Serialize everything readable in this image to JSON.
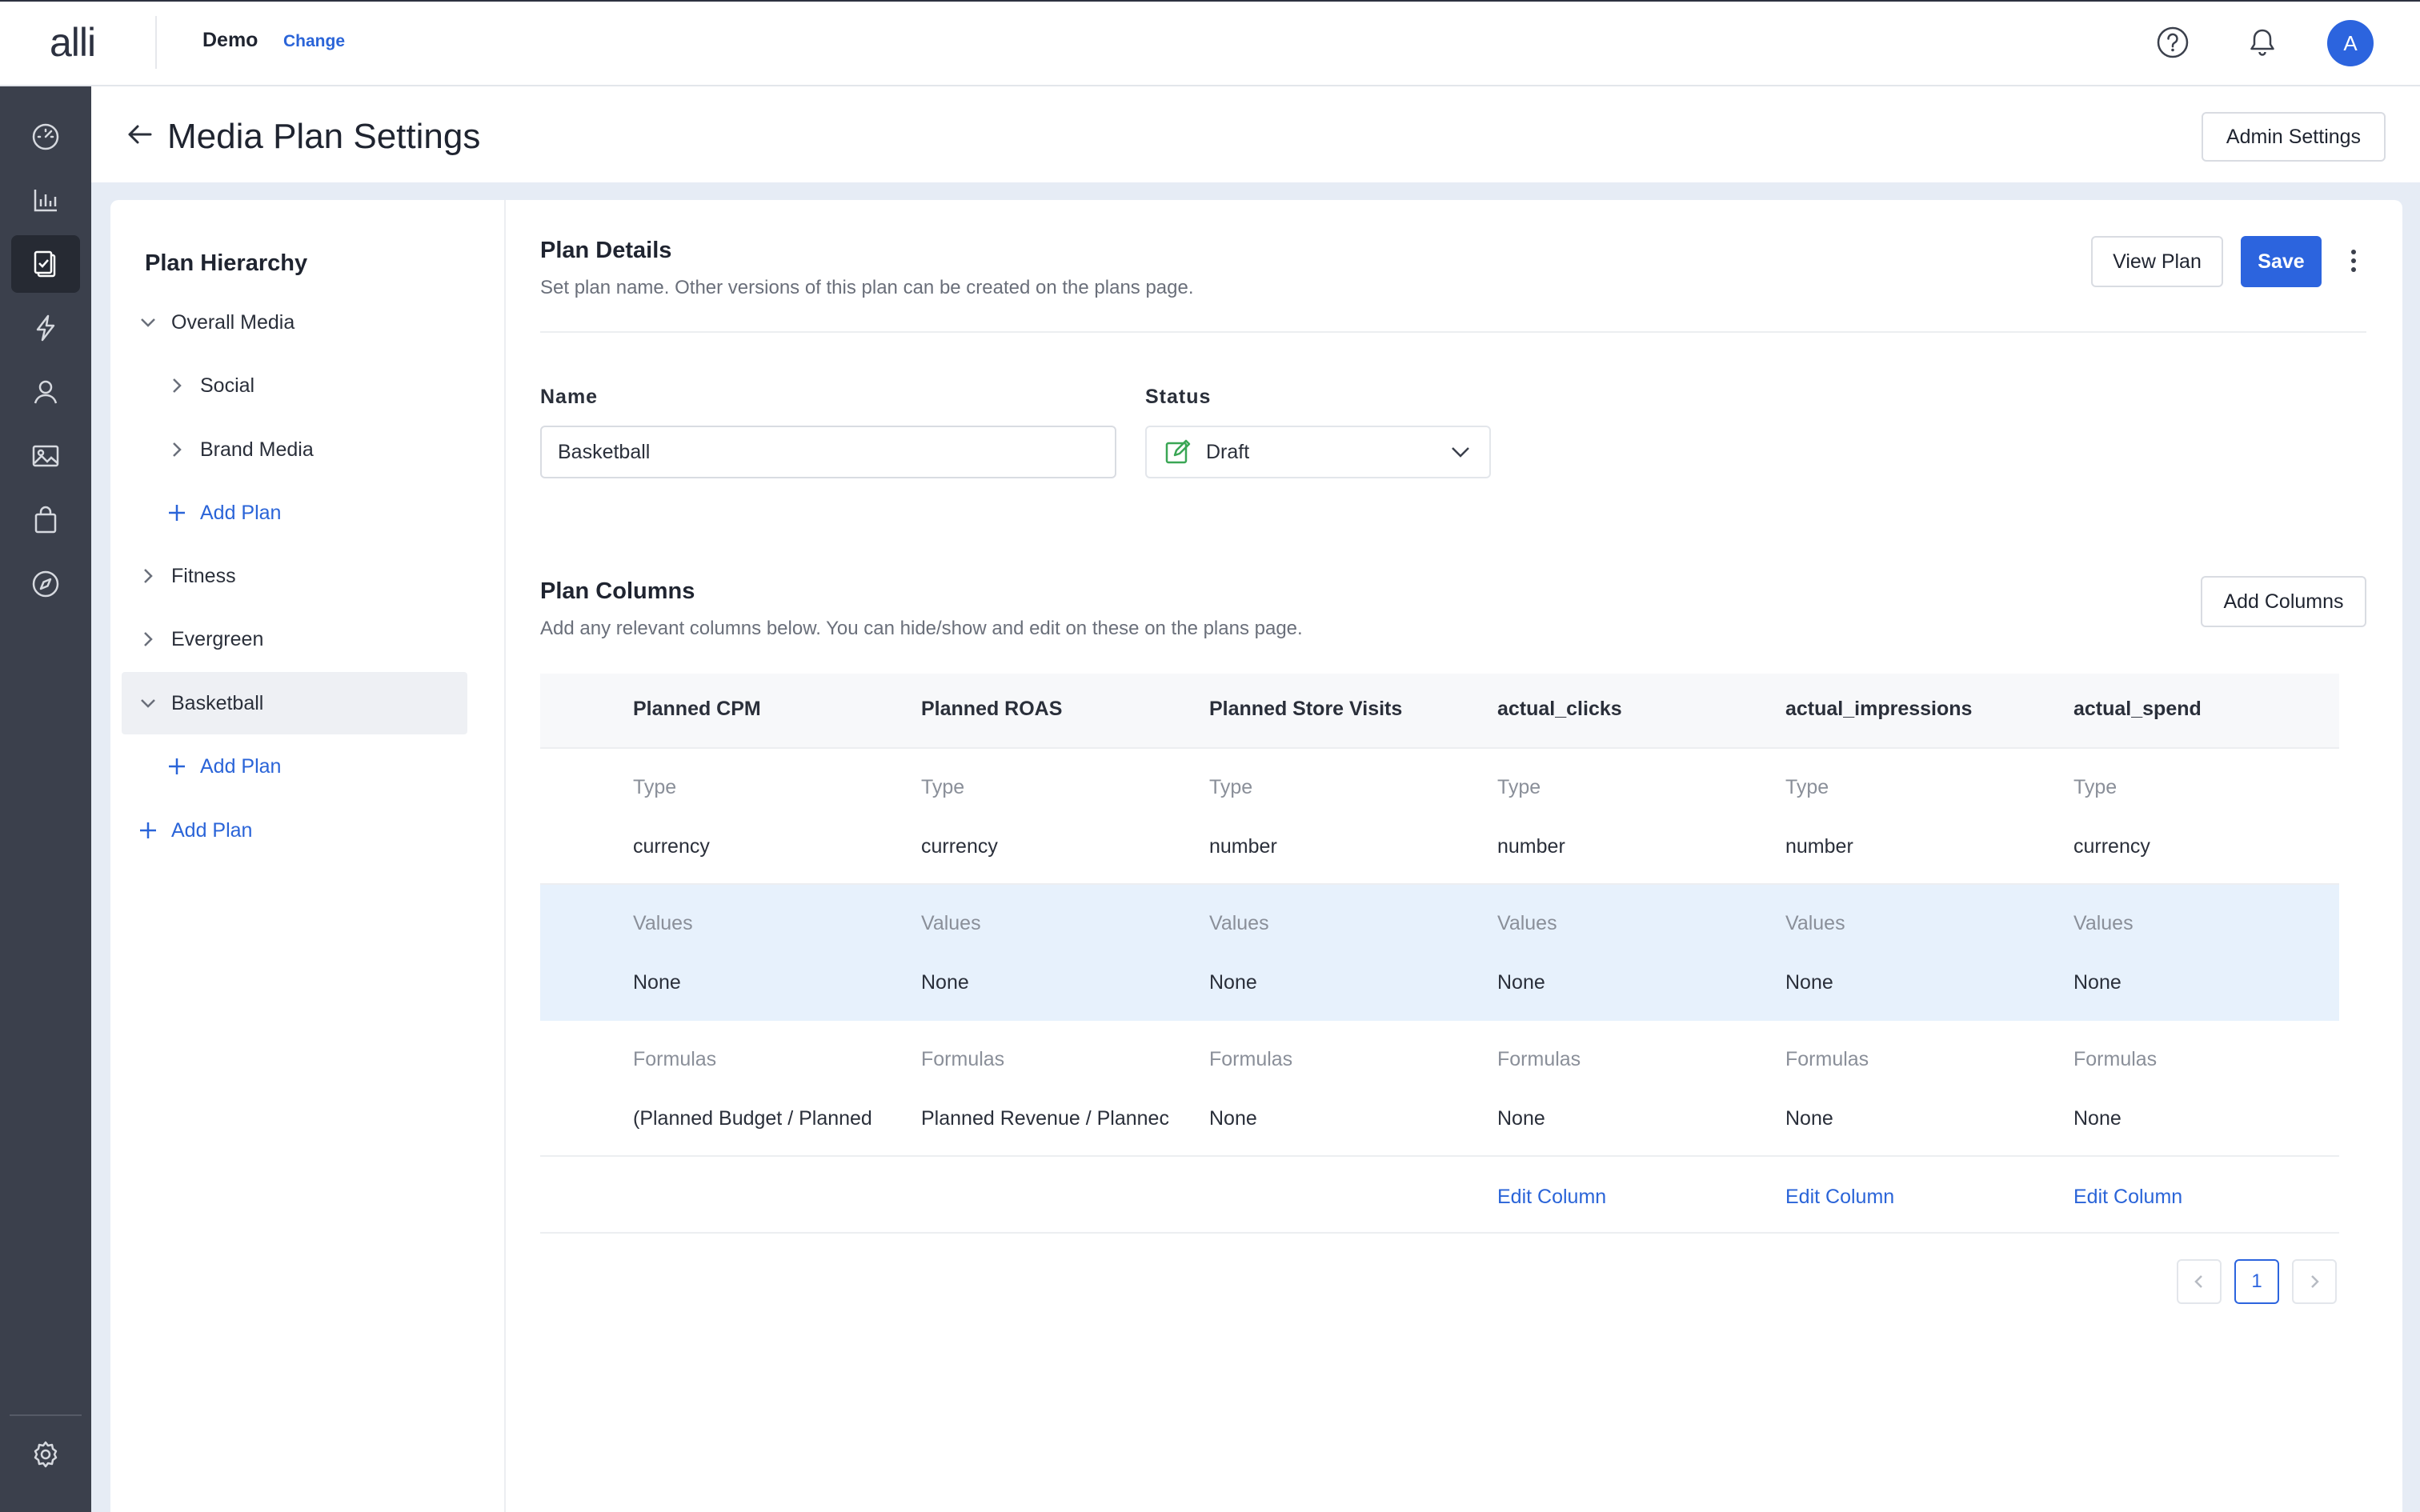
{
  "app": {
    "logo": "alli",
    "account_name": "Demo",
    "account_change": "Change",
    "avatar_initial": "A"
  },
  "nav": {
    "items": [
      "dashboard-icon",
      "chart-bar-icon",
      "clipboard-check-icon",
      "lightning-icon",
      "audience-icon",
      "image-icon",
      "shopping-bag-icon",
      "compass-icon"
    ],
    "active": "clipboard-check-icon",
    "footer": "gear-icon"
  },
  "header": {
    "title": "Media Plan Settings",
    "admin_button": "Admin Settings"
  },
  "hierarchy": {
    "title": "Plan Hierarchy",
    "items": [
      {
        "label": "Overall Media",
        "expanded": true
      },
      {
        "label": "Social"
      },
      {
        "label": "Brand Media"
      },
      {
        "label": "Add Plan"
      },
      {
        "label": "Fitness"
      },
      {
        "label": "Evergreen"
      },
      {
        "label": "Basketball",
        "selected": true,
        "expanded": true
      },
      {
        "label": "Add Plan"
      },
      {
        "label": "Add Plan"
      }
    ]
  },
  "details": {
    "title": "Plan Details",
    "description": "Set plan name. Other versions of this plan can be created on the plans page.",
    "view_plan": "View Plan",
    "save": "Save",
    "name_label": "Name",
    "name_value": "Basketball",
    "status_label": "Status",
    "status_value": "Draft"
  },
  "columns": {
    "title": "Plan Columns",
    "description": "Add any relevant columns below. You can hide/show and edit on these on the plans page.",
    "add_button": "Add Columns",
    "type_label": "Type",
    "values_label": "Values",
    "formulas_label": "Formulas",
    "edit_label": "Edit Column",
    "items": [
      {
        "header": "Planned CPM",
        "type": "currency",
        "values": "None",
        "formula": "(Planned Budget / Planned"
      },
      {
        "header": "Planned ROAS",
        "type": "currency",
        "values": "None",
        "formula": "Planned Revenue / Plannec"
      },
      {
        "header": "Planned Store Visits",
        "type": "number",
        "values": "None",
        "formula": "None"
      },
      {
        "header": "actual_clicks",
        "type": "number",
        "values": "None",
        "formula": "None",
        "editable": true
      },
      {
        "header": "actual_impressions",
        "type": "number",
        "values": "None",
        "formula": "None",
        "editable": true
      },
      {
        "header": "actual_spend",
        "type": "currency",
        "values": "None",
        "formula": "None",
        "editable": true
      }
    ]
  },
  "pagination": {
    "current": "1"
  },
  "colors": {
    "accent": "#2c64de",
    "nav_bg": "#3b404c",
    "highlight_row": "#e7f1fc",
    "status_icon": "#3aa655"
  }
}
